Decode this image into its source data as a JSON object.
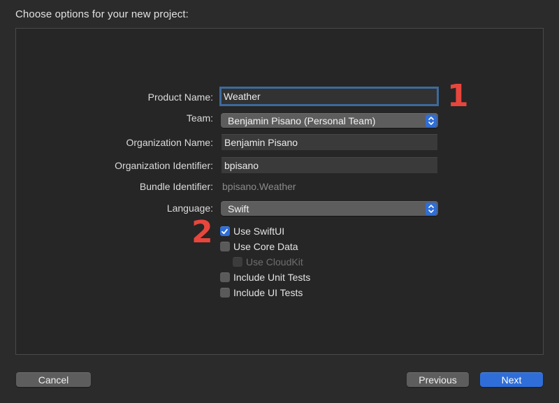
{
  "dialog": {
    "title": "Choose options for your new project:"
  },
  "form": {
    "product_name": {
      "label": "Product Name:",
      "value": "Weather"
    },
    "team": {
      "label": "Team:",
      "value": "Benjamin Pisano (Personal Team)"
    },
    "organization_name": {
      "label": "Organization Name:",
      "value": "Benjamin Pisano"
    },
    "organization_identifier": {
      "label": "Organization Identifier:",
      "value": "bpisano"
    },
    "bundle_identifier": {
      "label": "Bundle Identifier:",
      "value": "bpisano.Weather"
    },
    "language": {
      "label": "Language:",
      "value": "Swift"
    },
    "checkboxes": [
      {
        "label": "Use SwiftUI",
        "checked": true,
        "enabled": true
      },
      {
        "label": "Use Core Data",
        "checked": false,
        "enabled": true
      },
      {
        "label": "Use CloudKit",
        "checked": false,
        "enabled": false
      },
      {
        "label": "Include Unit Tests",
        "checked": false,
        "enabled": true
      },
      {
        "label": "Include UI Tests",
        "checked": false,
        "enabled": true
      }
    ]
  },
  "annotations": {
    "first": "1",
    "second": "2",
    "color": "#e8463c"
  },
  "buttons": {
    "cancel": "Cancel",
    "previous": "Previous",
    "next": "Next"
  },
  "colors": {
    "accent": "#2f6ed8",
    "focus_ring": "#3d6a9c",
    "background": "#2b2b2b"
  },
  "icons": {
    "popup_indicator": "up-down-chevron-icon",
    "check": "checkmark-icon"
  }
}
